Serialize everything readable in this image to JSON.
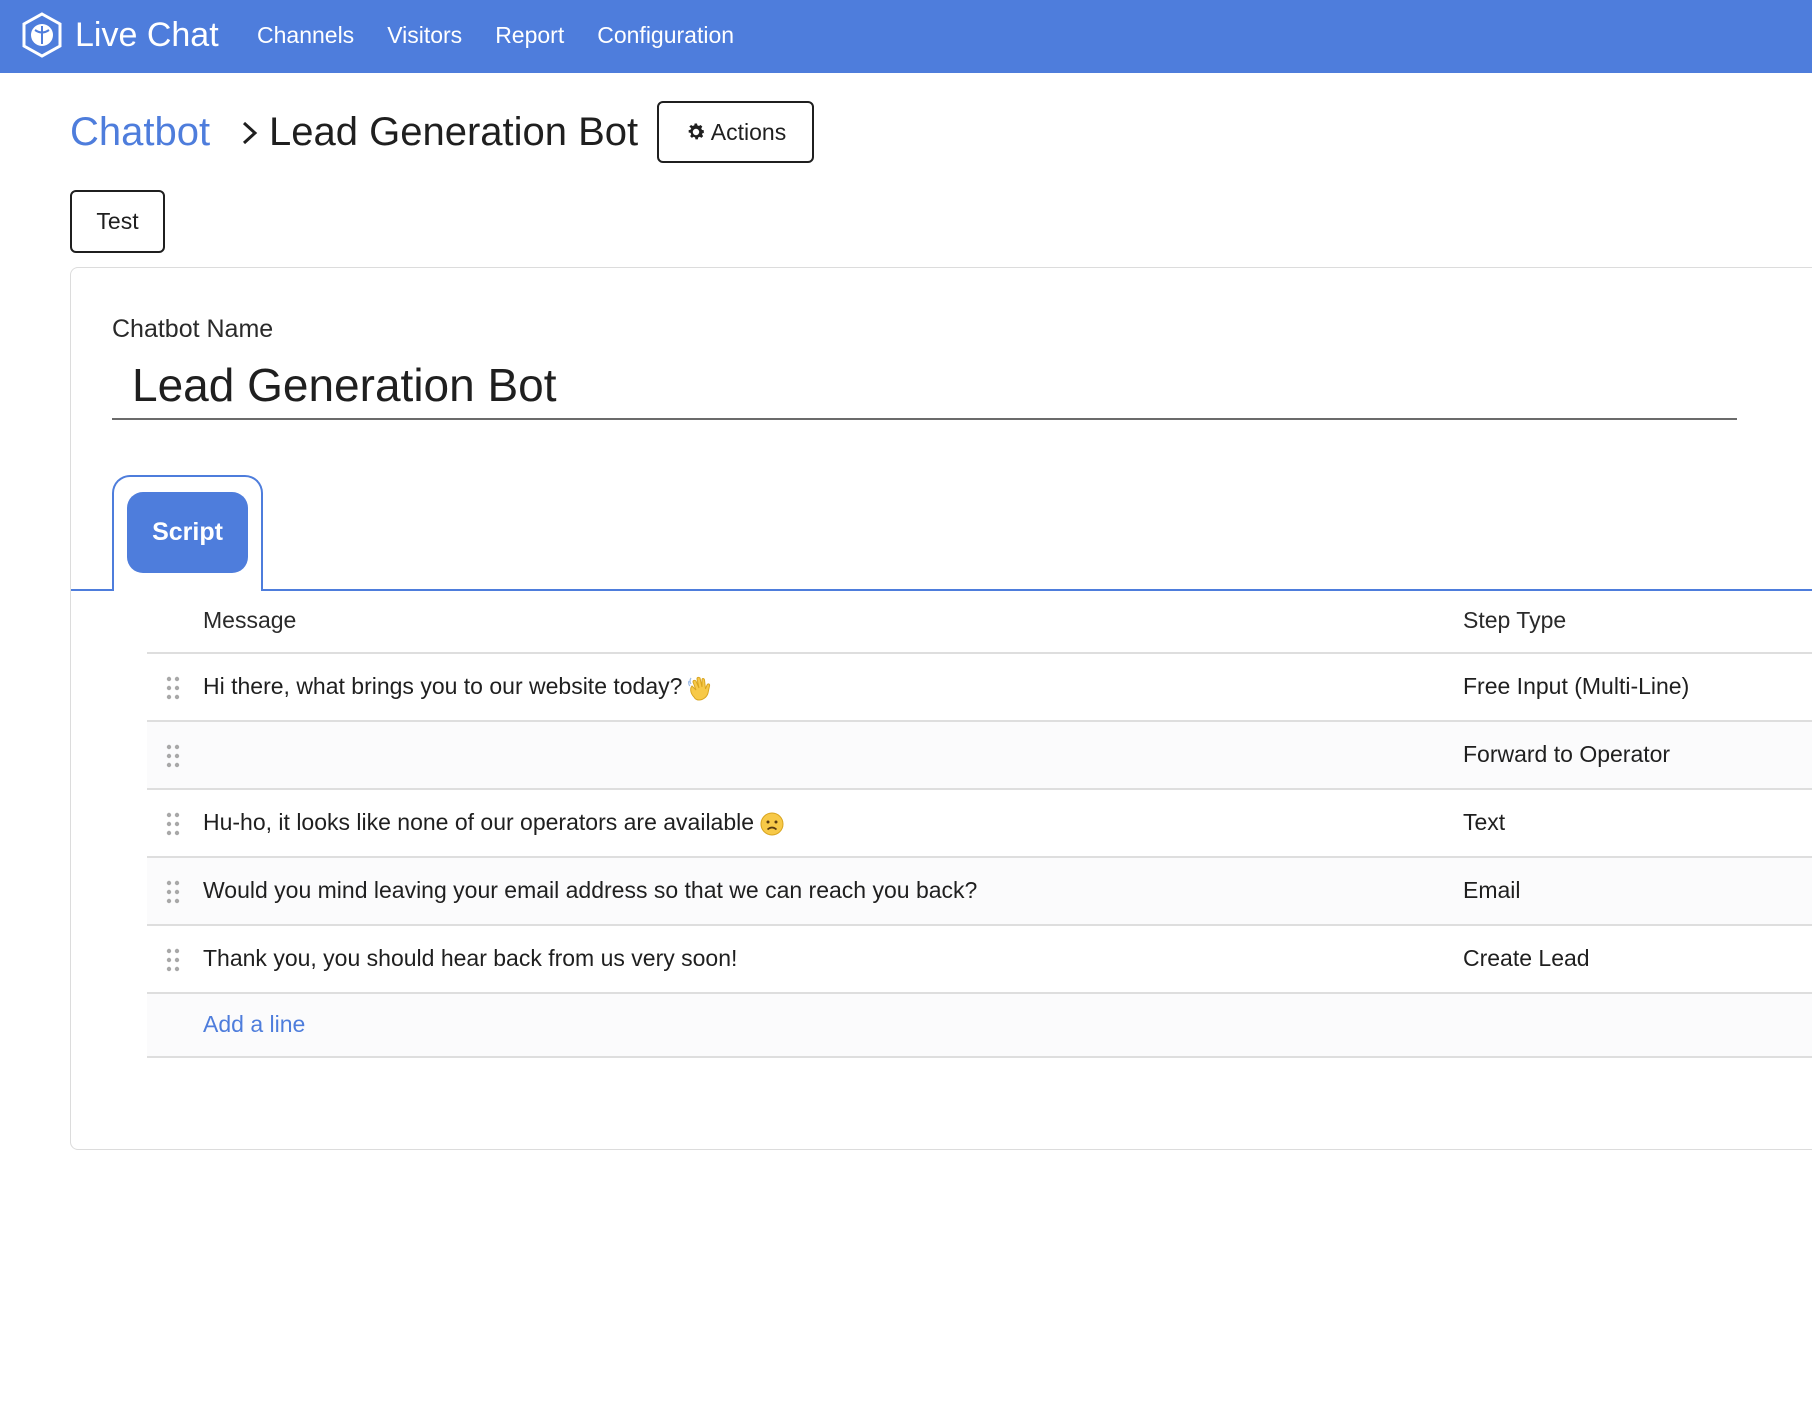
{
  "app": {
    "title": "Live Chat",
    "logo_icon": "live-chat-logo-icon",
    "brand_color": "#4e7ddc"
  },
  "nav": {
    "items": [
      {
        "label": "Channels"
      },
      {
        "label": "Visitors"
      },
      {
        "label": "Report"
      },
      {
        "label": "Configuration"
      }
    ]
  },
  "breadcrumb": {
    "parent": "Chatbot",
    "separator_icon": "chevron-right-icon",
    "current": "Lead Generation Bot"
  },
  "toolbar": {
    "actions_label": "Actions",
    "actions_icon": "gear-icon",
    "test_label": "Test"
  },
  "form": {
    "name_label": "Chatbot Name",
    "name_value": "Lead Generation Bot"
  },
  "tabs": [
    {
      "label": "Script",
      "active": true
    }
  ],
  "script_table": {
    "columns": {
      "message": "Message",
      "step_type": "Step Type"
    },
    "rows": [
      {
        "message": "Hi there, what brings you to our website today?",
        "emoji": "waving-hand-icon",
        "step_type": "Free Input (Multi-Line)"
      },
      {
        "message": "",
        "emoji": "",
        "step_type": "Forward to Operator"
      },
      {
        "message": "Hu-ho, it looks like none of our operators are available",
        "emoji": "sad-face-icon",
        "step_type": "Text"
      },
      {
        "message": "Would you mind leaving your email address so that we can reach you back?",
        "emoji": "",
        "step_type": "Email"
      },
      {
        "message": "Thank you, you should hear back from us very soon!",
        "emoji": "",
        "step_type": "Create Lead"
      }
    ],
    "add_line_label": "Add a line"
  }
}
